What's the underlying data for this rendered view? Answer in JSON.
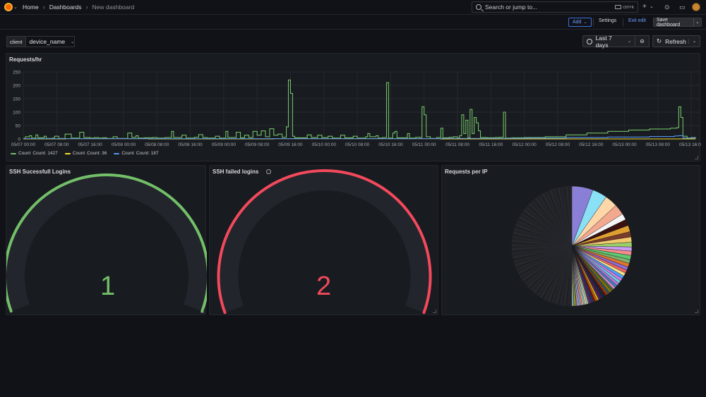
{
  "topbar": {
    "breadcrumb": [
      "Home",
      "Dashboards",
      "New dashboard"
    ],
    "search_placeholder": "Search or jump to...",
    "search_shortcut": "ctrl+k"
  },
  "toolbar": {
    "add_label": "Add",
    "settings_label": "Settings",
    "exit_edit_label": "Exit edit",
    "save_label": "Save dashboard"
  },
  "variables": {
    "label": "client",
    "value": "device_name"
  },
  "time_picker": {
    "range_label": "Last 7 days",
    "refresh_label": "Refresh"
  },
  "colors": {
    "green": "#73bf69",
    "yellow": "#fade2a",
    "blue": "#5794f2",
    "red": "#f2495c"
  },
  "panels": {
    "requests": {
      "title": "Requests/hr",
      "legend": [
        {
          "name": "Count",
          "stat": "Count: 1427",
          "color": "#73bf69"
        },
        {
          "name": "Count",
          "stat": "Count: 36",
          "color": "#fade2a"
        },
        {
          "name": "Count",
          "stat": "Count: 187",
          "color": "#5794f2"
        }
      ]
    },
    "ssh_success": {
      "title": "SSH Sucessfull Logins",
      "value": "1",
      "color": "#73bf69",
      "fraction": 1.0
    },
    "ssh_failed": {
      "title": "SSH failed logins",
      "value": "2",
      "color": "#f2495c",
      "fraction": 1.0
    },
    "requests_ip": {
      "title": "Requests per IP"
    }
  },
  "chart_data": [
    {
      "type": "line",
      "title": "Requests/hr",
      "ylim": [
        0,
        250
      ],
      "yticks": [
        0,
        50,
        100,
        150,
        200,
        250
      ],
      "xlim": [
        0,
        162
      ],
      "xticks": [
        {
          "t": 0,
          "label": "05/07 00:00"
        },
        {
          "t": 8,
          "label": "05/07 08:00"
        },
        {
          "t": 16,
          "label": "05/07 16:00"
        },
        {
          "t": 24,
          "label": "05/08 00:00"
        },
        {
          "t": 32,
          "label": "05/08 08:00"
        },
        {
          "t": 40,
          "label": "05/08 16:00"
        },
        {
          "t": 48,
          "label": "05/09 00:00"
        },
        {
          "t": 56,
          "label": "05/09 08:00"
        },
        {
          "t": 64,
          "label": "05/09 16:00"
        },
        {
          "t": 72,
          "label": "05/10 00:00"
        },
        {
          "t": 80,
          "label": "05/10 08:00"
        },
        {
          "t": 88,
          "label": "05/10 16:00"
        },
        {
          "t": 96,
          "label": "05/11 00:00"
        },
        {
          "t": 104,
          "label": "05/11 08:00"
        },
        {
          "t": 112,
          "label": "05/11 16:00"
        },
        {
          "t": 120,
          "label": "05/12 00:00"
        },
        {
          "t": 128,
          "label": "05/12 08:00"
        },
        {
          "t": 136,
          "label": "05/12 16:00"
        },
        {
          "t": 144,
          "label": "05/13 00:00"
        },
        {
          "t": 152,
          "label": "05/13 08:00"
        },
        {
          "t": 160,
          "label": "05/13 16:00"
        }
      ],
      "series": [
        {
          "name": "Count",
          "color": "#73bf69",
          "points": [
            [
              0,
              2
            ],
            [
              0.5,
              8
            ],
            [
              1.5,
              12
            ],
            [
              2,
              3
            ],
            [
              3,
              15
            ],
            [
              3.5,
              4
            ],
            [
              5,
              10
            ],
            [
              5.5,
              2
            ],
            [
              7,
              3
            ],
            [
              7.5,
              10
            ],
            [
              8.5,
              2
            ],
            [
              10,
              18
            ],
            [
              11,
              18
            ],
            [
              11.5,
              3
            ],
            [
              13.5,
              25
            ],
            [
              14.5,
              5
            ],
            [
              16,
              3
            ],
            [
              17,
              5
            ],
            [
              18,
              3
            ],
            [
              19,
              4
            ],
            [
              20,
              2
            ],
            [
              21.5,
              8
            ],
            [
              22.5,
              2
            ],
            [
              25,
              22
            ],
            [
              26,
              6
            ],
            [
              27,
              12
            ],
            [
              27.5,
              3
            ],
            [
              29,
              4
            ],
            [
              31,
              5
            ],
            [
              32,
              3
            ],
            [
              34,
              5
            ],
            [
              35.5,
              28
            ],
            [
              36,
              5
            ],
            [
              38,
              14
            ],
            [
              39,
              3
            ],
            [
              41,
              6
            ],
            [
              42,
              16
            ],
            [
              43,
              5
            ],
            [
              44,
              3
            ],
            [
              46,
              10
            ],
            [
              47,
              3
            ],
            [
              48.5,
              28
            ],
            [
              49,
              5
            ],
            [
              51,
              25
            ],
            [
              52,
              4
            ],
            [
              53,
              14
            ],
            [
              54,
              5
            ],
            [
              55,
              28
            ],
            [
              56,
              14
            ],
            [
              57,
              30
            ],
            [
              58,
              8
            ],
            [
              59,
              38
            ],
            [
              60,
              14
            ],
            [
              61,
              18
            ],
            [
              62,
              6
            ],
            [
              63,
              45
            ],
            [
              63.5,
              220
            ],
            [
              64,
              170
            ],
            [
              64.5,
              10
            ],
            [
              65,
              4
            ],
            [
              67,
              4
            ],
            [
              68,
              15
            ],
            [
              69,
              5
            ],
            [
              70.5,
              14
            ],
            [
              71.5,
              5
            ],
            [
              73,
              10
            ],
            [
              74,
              3
            ],
            [
              76,
              14
            ],
            [
              77,
              4
            ],
            [
              79,
              10
            ],
            [
              80,
              3
            ],
            [
              82,
              8
            ],
            [
              82.5,
              20
            ],
            [
              83,
              8
            ],
            [
              84.5,
              12
            ],
            [
              85,
              3
            ],
            [
              86,
              5
            ],
            [
              87,
              210
            ],
            [
              87.5,
              3
            ],
            [
              88.5,
              22
            ],
            [
              89,
              28
            ],
            [
              89.5,
              4
            ],
            [
              91,
              4
            ],
            [
              92,
              20
            ],
            [
              92.5,
              3
            ],
            [
              94,
              6
            ],
            [
              95,
              5
            ],
            [
              95.5,
              120
            ],
            [
              96,
              90
            ],
            [
              96.5,
              8
            ],
            [
              97.5,
              2
            ],
            [
              99,
              5
            ],
            [
              100,
              40
            ],
            [
              100.5,
              4
            ],
            [
              102,
              6
            ],
            [
              103,
              8
            ],
            [
              104,
              3
            ],
            [
              104.5,
              12
            ],
            [
              105,
              90
            ],
            [
              105.5,
              20
            ],
            [
              106,
              70
            ],
            [
              106.5,
              4
            ],
            [
              107,
              110
            ],
            [
              107.5,
              20
            ],
            [
              108,
              80
            ],
            [
              108.5,
              60
            ],
            [
              109,
              30
            ],
            [
              109.5,
              5
            ],
            [
              111,
              4
            ],
            [
              113,
              5
            ],
            [
              114,
              6
            ],
            [
              115,
              100
            ],
            [
              115.5,
              3
            ],
            [
              117,
              4
            ],
            [
              120,
              5
            ],
            [
              125,
              8
            ],
            [
              130,
              15
            ],
            [
              135,
              22
            ],
            [
              140,
              28
            ],
            [
              145,
              33
            ],
            [
              150,
              37
            ],
            [
              155,
              40
            ],
            [
              156.5,
              42
            ],
            [
              157,
              120
            ],
            [
              157.5,
              80
            ],
            [
              158,
              10
            ],
            [
              159,
              3
            ],
            [
              160,
              5
            ],
            [
              161,
              2
            ]
          ]
        },
        {
          "name": "Count",
          "color": "#fade2a",
          "points": [
            [
              0,
              0
            ],
            [
              10,
              0
            ],
            [
              10.2,
              1
            ],
            [
              30,
              0
            ],
            [
              60,
              1
            ],
            [
              100,
              0
            ],
            [
              161,
              0
            ]
          ]
        },
        {
          "name": "Count",
          "color": "#5794f2",
          "points": [
            [
              0,
              1
            ],
            [
              40,
              1
            ],
            [
              80,
              1
            ],
            [
              100,
              2
            ],
            [
              120,
              3
            ],
            [
              130,
              5
            ],
            [
              140,
              7
            ],
            [
              150,
              9
            ],
            [
              156,
              11
            ],
            [
              157,
              12
            ],
            [
              158,
              3
            ],
            [
              161,
              2
            ]
          ]
        }
      ]
    },
    {
      "type": "pie",
      "title": "Requests per IP",
      "values": [
        10,
        7,
        6,
        5,
        3,
        3,
        3,
        2.5,
        2.5,
        2.2,
        2,
        2,
        2,
        1.8,
        1.8,
        1.6,
        1.5,
        1.5,
        1.4,
        1.4,
        1.3,
        1.3,
        1.2,
        1.2,
        1.2,
        1.1,
        1.1,
        1,
        1,
        1,
        1,
        1,
        0.9,
        0.9,
        0.9,
        0.9,
        0.8,
        0.8,
        0.8,
        0.8,
        0.7,
        0.7,
        0.7,
        0.7,
        0.6,
        0.6,
        0.6,
        0.6,
        0.5,
        0.5
      ],
      "colors": [
        "#8a7fd6",
        "#8ae0f5",
        "#fdd7a8",
        "#f3a98f",
        "#f5f5f5",
        "#3a1010",
        "#e0a030",
        "#7a3c2a",
        "#f2c96d",
        "#9ad069",
        "#c99cf4",
        "#f58c8c",
        "#5ec96f",
        "#7eb26d",
        "#e0752d",
        "#8e6cd6",
        "#ea6460",
        "#f5e28a",
        "#4da6ff",
        "#cd7de5",
        "#6ed0e0",
        "#b877d9",
        "#447ebc",
        "#d683ce",
        "#3f6833",
        "#967302",
        "#2f575e",
        "#99440a",
        "#58140c",
        "#052b51",
        "#511749",
        "#3f2b5b",
        "#e5ac0e",
        "#c15c17",
        "#890f02",
        "#0a437c",
        "#6d1f62",
        "#584477",
        "#b7dbab",
        "#f4d598",
        "#70dbed",
        "#f9ba8f",
        "#f29191",
        "#82b5d8",
        "#e5a8e2",
        "#aea2e0",
        "#629e51",
        "#e5ac0e",
        "#64b0c8",
        "#e0f9d7"
      ]
    }
  ]
}
